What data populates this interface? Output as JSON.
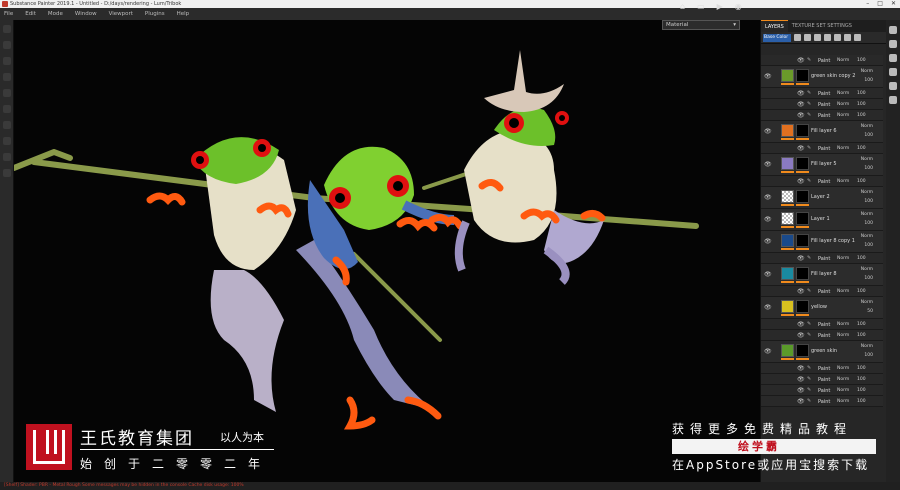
{
  "window": {
    "title": "Substance Painter 2019.1 - Untitled - D:/days/rendering - Lum/Tribok"
  },
  "menu": [
    "File",
    "Edit",
    "Mode",
    "Window",
    "Viewport",
    "Plugins",
    "Help"
  ],
  "viewport": {
    "display_mode": "Material"
  },
  "panel": {
    "tabs": [
      "LAYERS",
      "TEXTURE SET SETTINGS"
    ],
    "blend_mode": "Base Color",
    "layers": [
      {
        "type": "sub",
        "name": "Paint",
        "blend": "Norm",
        "opacity": "100"
      },
      {
        "type": "layer",
        "name": "green skin copy 2",
        "thumb": "#6a9a2a",
        "blend": "Norm",
        "opacity": "100"
      },
      {
        "type": "sub",
        "name": "Paint",
        "blend": "Norm",
        "opacity": "100"
      },
      {
        "type": "sub",
        "name": "Paint",
        "blend": "Norm",
        "opacity": "100"
      },
      {
        "type": "sub",
        "name": "Paint",
        "blend": "Norm",
        "opacity": "100"
      },
      {
        "type": "layer",
        "name": "Fill layer 6",
        "thumb": "#e07020",
        "blend": "Norm",
        "opacity": "100"
      },
      {
        "type": "sub",
        "name": "Paint",
        "blend": "Norm",
        "opacity": "100"
      },
      {
        "type": "layer",
        "name": "Fill layer 5",
        "thumb": "#8a7ac0",
        "blend": "Norm",
        "opacity": "100"
      },
      {
        "type": "sub",
        "name": "Paint",
        "blend": "Norm",
        "opacity": "100"
      },
      {
        "type": "layer",
        "name": "Layer 2",
        "thumb": "checker",
        "blend": "Norm",
        "opacity": "100"
      },
      {
        "type": "layer",
        "name": "Layer 1",
        "thumb": "checker",
        "blend": "Norm",
        "opacity": "100"
      },
      {
        "type": "layer",
        "name": "Fill layer 8 copy 1",
        "thumb": "#1a4a8a",
        "blend": "Norm",
        "opacity": "100"
      },
      {
        "type": "sub",
        "name": "Paint",
        "blend": "Norm",
        "opacity": "100"
      },
      {
        "type": "layer",
        "name": "Fill layer 8",
        "thumb": "#1a8aa0",
        "blend": "Norm",
        "opacity": "100"
      },
      {
        "type": "sub",
        "name": "Paint",
        "blend": "Norm",
        "opacity": "100"
      },
      {
        "type": "layer",
        "name": "yellow",
        "thumb": "#d8c020",
        "blend": "Norm",
        "opacity": "50"
      },
      {
        "type": "sub",
        "name": "Paint",
        "blend": "Norm",
        "opacity": "100"
      },
      {
        "type": "sub",
        "name": "Paint",
        "blend": "Norm",
        "opacity": "100"
      },
      {
        "type": "layer",
        "name": "green skin",
        "thumb": "#5a9a2a",
        "blend": "Norm",
        "opacity": "100"
      },
      {
        "type": "sub",
        "name": "Paint",
        "blend": "Norm",
        "opacity": "100"
      },
      {
        "type": "sub",
        "name": "Paint",
        "blend": "Norm",
        "opacity": "100"
      },
      {
        "type": "sub",
        "name": "Paint",
        "blend": "Norm",
        "opacity": "100"
      },
      {
        "type": "sub",
        "name": "Paint",
        "blend": "Norm",
        "opacity": "100"
      }
    ]
  },
  "statusbar": {
    "text": "[Shelf] Shader: PBR - Metal Rough  Some messages may be hidden in the console  Cache disk usage: 100%"
  },
  "watermark": {
    "org": "王氏教育集团",
    "slogan": "以人为本",
    "since": "始创于二零零二年",
    "promo": "获得更多免费精品教程",
    "brand": "绘学霸",
    "download": "在AppStore或应用宝搜索下载"
  },
  "colors": {
    "accent": "#f08a1c",
    "selected": "#2b5fa8",
    "watermark_red": "#c0111f"
  }
}
